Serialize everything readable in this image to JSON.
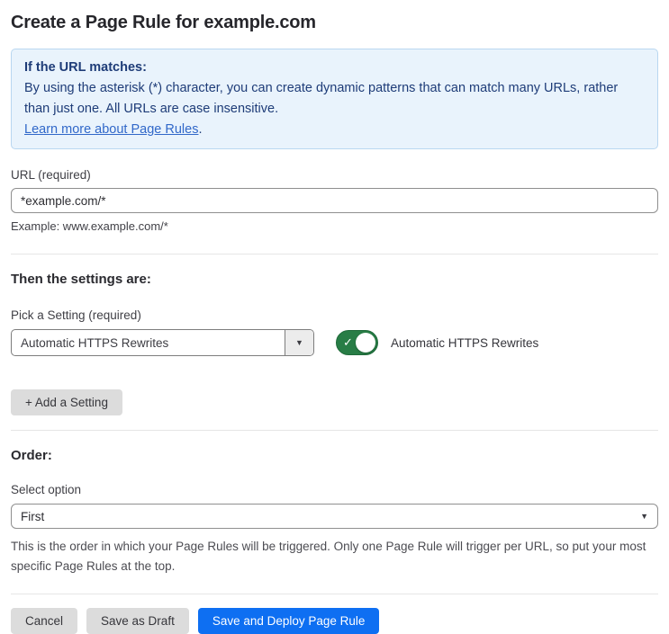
{
  "page": {
    "title": "Create a Page Rule for example.com"
  },
  "info_box": {
    "heading": "If the URL matches:",
    "body": "By using the asterisk (*) character, you can create dynamic patterns that can match many URLs, rather than just one. All URLs are case insensitive.",
    "link_label": "Learn more about Page Rules",
    "link_suffix": "."
  },
  "url_field": {
    "label": "URL (required)",
    "value": "*example.com/*",
    "helper": "Example: www.example.com/*"
  },
  "settings_section": {
    "heading": "Then the settings are:",
    "picker_label": "Pick a Setting (required)",
    "picker_value": "Automatic HTTPS Rewrites",
    "picker_arrow": "▼",
    "toggle_state": "on",
    "toggle_check": "✓",
    "toggle_label": "Automatic HTTPS Rewrites",
    "add_setting_button": "+ Add a Setting"
  },
  "order_section": {
    "heading": "Order:",
    "select_label": "Select option",
    "select_value": "First",
    "select_arrow": "▼",
    "helper": "This is the order in which your Page Rules will be triggered. Only one Page Rule will trigger per URL, so put your most specific Page Rules at the top."
  },
  "footer": {
    "cancel_label": "Cancel",
    "save_draft_label": "Save as Draft",
    "save_deploy_label": "Save and Deploy Page Rule"
  },
  "colors": {
    "info_bg": "#e9f3fc",
    "info_border": "#b9d7f1",
    "info_text": "#1e3c78",
    "link_blue": "#3168c9",
    "toggle_green": "#287d46",
    "primary_blue": "#0e6ff2",
    "gray_button_bg": "#dcdcdc"
  }
}
